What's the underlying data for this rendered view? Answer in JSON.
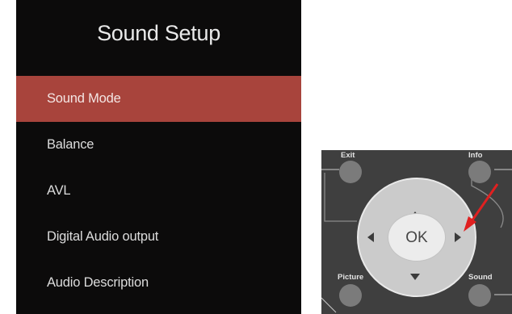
{
  "menu": {
    "title": "Sound Setup",
    "items": [
      {
        "label": "Sound Mode",
        "selected": true
      },
      {
        "label": "Balance"
      },
      {
        "label": "AVL"
      },
      {
        "label": "Digital Audio output"
      },
      {
        "label": "Audio Description"
      }
    ],
    "colors": {
      "background": "#0c0b0b",
      "highlight": "#a8443c"
    }
  },
  "remote": {
    "exit_label": "Exit",
    "info_label": "Info",
    "picture_label": "Picture",
    "sound_label": "Sound",
    "ok_label": "OK",
    "highlighted_key": "right-arrow",
    "colors": {
      "body": "#3f3f3f",
      "pointer": "#e02020"
    }
  }
}
